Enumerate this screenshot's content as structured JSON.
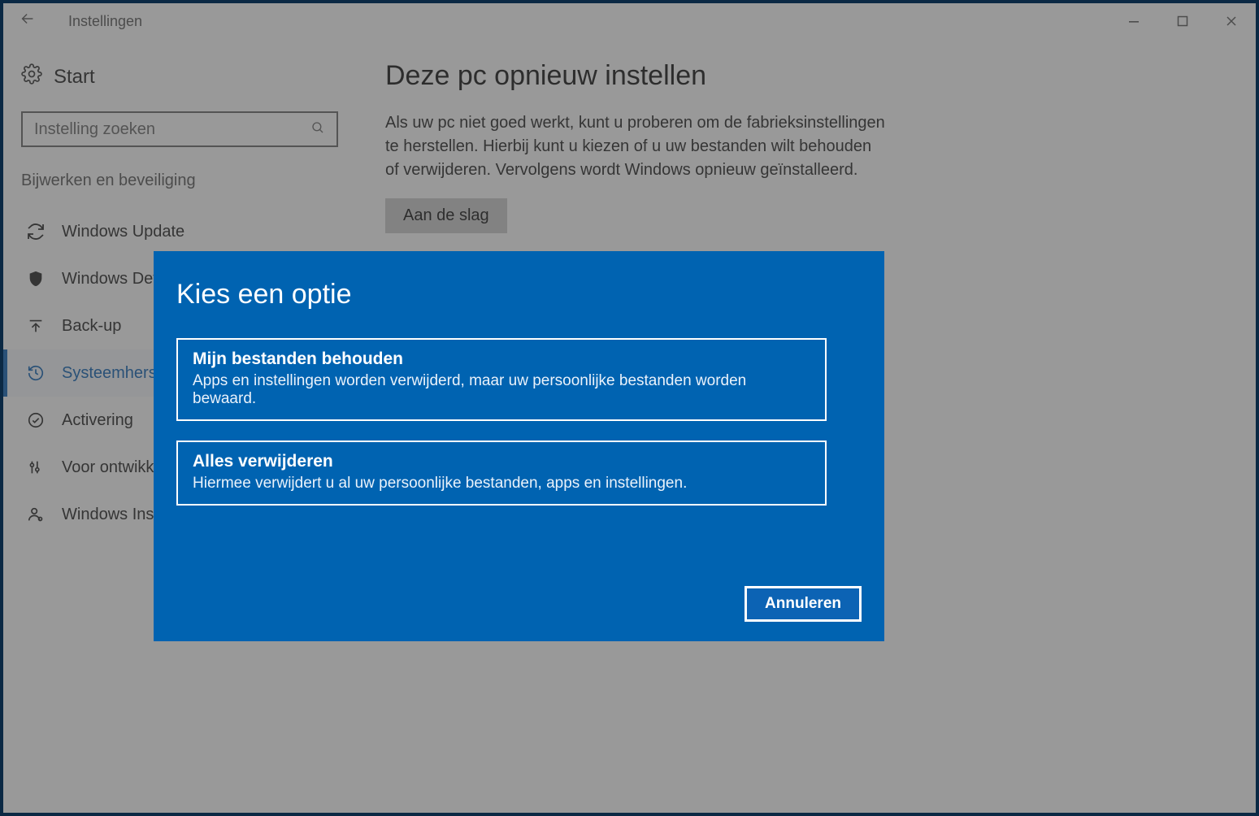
{
  "titlebar": {
    "title": "Instellingen"
  },
  "sidebar": {
    "start_label": "Start",
    "search_placeholder": "Instelling zoeken",
    "category": "Bijwerken en beveiliging",
    "items": [
      {
        "label": "Windows Update"
      },
      {
        "label": "Windows Def"
      },
      {
        "label": "Back-up"
      },
      {
        "label": "Systeemherst"
      },
      {
        "label": "Activering"
      },
      {
        "label": "Voor ontwikk"
      },
      {
        "label": "Windows Insi"
      }
    ]
  },
  "main": {
    "heading": "Deze pc opnieuw instellen",
    "description": "Als uw pc niet goed werkt, kunt u proberen om de fabrieksinstellingen te herstellen. Hierbij kunt u kiezen of u uw bestanden wilt behouden of verwijderen. Vervolgens wordt Windows opnieuw geïnstalleerd.",
    "button_label": "Aan de slag"
  },
  "dialog": {
    "title": "Kies een optie",
    "options": [
      {
        "title": "Mijn bestanden behouden",
        "desc": "Apps en instellingen worden verwijderd, maar uw persoonlijke bestanden worden bewaard."
      },
      {
        "title": "Alles verwijderen",
        "desc": "Hiermee verwijdert u al uw persoonlijke bestanden, apps en instellingen."
      }
    ],
    "cancel_label": "Annuleren"
  }
}
